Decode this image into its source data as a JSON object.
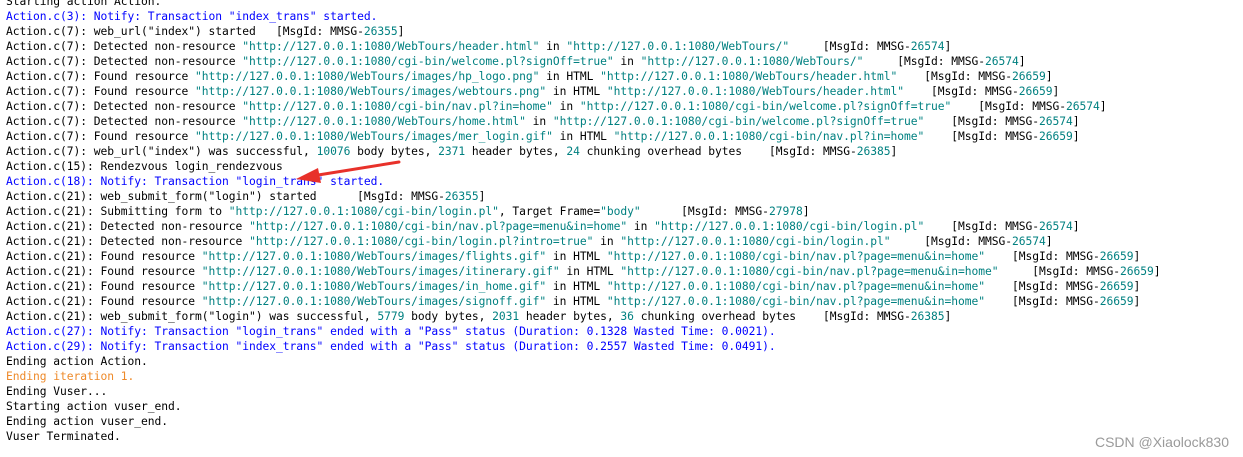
{
  "log": {
    "lines": [
      {
        "color": "black",
        "segs": [
          {
            "t": "Starting action Action."
          }
        ]
      },
      {
        "color": "blue",
        "segs": [
          {
            "t": "Action.c(3): Notify: Transaction \"index_trans\" started."
          }
        ]
      },
      {
        "color": "black",
        "segs": [
          {
            "t": "Action.c(7): web_url(\"index\") started   [MsgId: MMSG-"
          },
          {
            "t": "26355",
            "hl": true
          },
          {
            "t": "]"
          }
        ]
      },
      {
        "color": "black",
        "segs": [
          {
            "t": "Action.c(7): Detected non-resource "
          },
          {
            "t": "\"http://127.0.0.1:1080/WebTours/header.html\"",
            "hl": true
          },
          {
            "t": " in "
          },
          {
            "t": "\"http://127.0.0.1:1080/WebTours/\"",
            "hl": true
          },
          {
            "t": "     [MsgId: MMSG-"
          },
          {
            "t": "26574",
            "hl": true
          },
          {
            "t": "]"
          }
        ]
      },
      {
        "color": "black",
        "segs": [
          {
            "t": "Action.c(7): Detected non-resource "
          },
          {
            "t": "\"http://127.0.0.1:1080/cgi-bin/welcome.pl?signOff=true\"",
            "hl": true
          },
          {
            "t": " in "
          },
          {
            "t": "\"http://127.0.0.1:1080/WebTours/\"",
            "hl": true
          },
          {
            "t": "     [MsgId: MMSG-"
          },
          {
            "t": "26574",
            "hl": true
          },
          {
            "t": "]"
          }
        ]
      },
      {
        "color": "black",
        "segs": [
          {
            "t": "Action.c(7): Found resource "
          },
          {
            "t": "\"http://127.0.0.1:1080/WebTours/images/hp_logo.png\"",
            "hl": true
          },
          {
            "t": " in HTML "
          },
          {
            "t": "\"http://127.0.0.1:1080/WebTours/header.html\"",
            "hl": true
          },
          {
            "t": "    [MsgId: MMSG-"
          },
          {
            "t": "26659",
            "hl": true
          },
          {
            "t": "]"
          }
        ]
      },
      {
        "color": "black",
        "segs": [
          {
            "t": "Action.c(7): Found resource "
          },
          {
            "t": "\"http://127.0.0.1:1080/WebTours/images/webtours.png\"",
            "hl": true
          },
          {
            "t": " in HTML "
          },
          {
            "t": "\"http://127.0.0.1:1080/WebTours/header.html\"",
            "hl": true
          },
          {
            "t": "    [MsgId: MMSG-"
          },
          {
            "t": "26659",
            "hl": true
          },
          {
            "t": "]"
          }
        ]
      },
      {
        "color": "black",
        "segs": [
          {
            "t": "Action.c(7): Detected non-resource "
          },
          {
            "t": "\"http://127.0.0.1:1080/cgi-bin/nav.pl?in=home\"",
            "hl": true
          },
          {
            "t": " in "
          },
          {
            "t": "\"http://127.0.0.1:1080/cgi-bin/welcome.pl?signOff=true\"",
            "hl": true
          },
          {
            "t": "    [MsgId: MMSG-"
          },
          {
            "t": "26574",
            "hl": true
          },
          {
            "t": "]"
          }
        ]
      },
      {
        "color": "black",
        "segs": [
          {
            "t": "Action.c(7): Detected non-resource "
          },
          {
            "t": "\"http://127.0.0.1:1080/WebTours/home.html\"",
            "hl": true
          },
          {
            "t": " in "
          },
          {
            "t": "\"http://127.0.0.1:1080/cgi-bin/welcome.pl?signOff=true\"",
            "hl": true
          },
          {
            "t": "    [MsgId: MMSG-"
          },
          {
            "t": "26574",
            "hl": true
          },
          {
            "t": "]"
          }
        ]
      },
      {
        "color": "black",
        "segs": [
          {
            "t": "Action.c(7): Found resource "
          },
          {
            "t": "\"http://127.0.0.1:1080/WebTours/images/mer_login.gif\"",
            "hl": true
          },
          {
            "t": " in HTML "
          },
          {
            "t": "\"http://127.0.0.1:1080/cgi-bin/nav.pl?in=home\"",
            "hl": true
          },
          {
            "t": "    [MsgId: MMSG-"
          },
          {
            "t": "26659",
            "hl": true
          },
          {
            "t": "]"
          }
        ]
      },
      {
        "color": "black",
        "segs": [
          {
            "t": "Action.c(7): web_url(\"index\") was successful, "
          },
          {
            "t": "10076",
            "hl": true
          },
          {
            "t": " body bytes, "
          },
          {
            "t": "2371",
            "hl": true
          },
          {
            "t": " header bytes, "
          },
          {
            "t": "24",
            "hl": true
          },
          {
            "t": " chunking overhead bytes    [MsgId: MMSG-"
          },
          {
            "t": "26385",
            "hl": true
          },
          {
            "t": "]"
          }
        ]
      },
      {
        "color": "black",
        "segs": [
          {
            "t": "Action.c(15): Rendezvous login_rendezvous"
          }
        ]
      },
      {
        "color": "blue",
        "segs": [
          {
            "t": "Action.c(18): Notify: Transaction \"login_trans\" started."
          }
        ]
      },
      {
        "color": "black",
        "segs": [
          {
            "t": "Action.c(21): web_submit_form(\"login\") started      [MsgId: MMSG-"
          },
          {
            "t": "26355",
            "hl": true
          },
          {
            "t": "]"
          }
        ]
      },
      {
        "color": "black",
        "segs": [
          {
            "t": "Action.c(21): Submitting form to "
          },
          {
            "t": "\"http://127.0.0.1:1080/cgi-bin/login.pl\"",
            "hl": true
          },
          {
            "t": ", Target Frame="
          },
          {
            "t": "\"body\"",
            "hl": true
          },
          {
            "t": "      [MsgId: MMSG-"
          },
          {
            "t": "27978",
            "hl": true
          },
          {
            "t": "]"
          }
        ]
      },
      {
        "color": "black",
        "segs": [
          {
            "t": "Action.c(21): Detected non-resource "
          },
          {
            "t": "\"http://127.0.0.1:1080/cgi-bin/nav.pl?page=menu&in=home\"",
            "hl": true
          },
          {
            "t": " in "
          },
          {
            "t": "\"http://127.0.0.1:1080/cgi-bin/login.pl\"",
            "hl": true
          },
          {
            "t": "    [MsgId: MMSG-"
          },
          {
            "t": "26574",
            "hl": true
          },
          {
            "t": "]"
          }
        ]
      },
      {
        "color": "black",
        "segs": [
          {
            "t": "Action.c(21): Detected non-resource "
          },
          {
            "t": "\"http://127.0.0.1:1080/cgi-bin/login.pl?intro=true\"",
            "hl": true
          },
          {
            "t": " in "
          },
          {
            "t": "\"http://127.0.0.1:1080/cgi-bin/login.pl\"",
            "hl": true
          },
          {
            "t": "     [MsgId: MMSG-"
          },
          {
            "t": "26574",
            "hl": true
          },
          {
            "t": "]"
          }
        ]
      },
      {
        "color": "black",
        "segs": [
          {
            "t": "Action.c(21): Found resource "
          },
          {
            "t": "\"http://127.0.0.1:1080/WebTours/images/flights.gif\"",
            "hl": true
          },
          {
            "t": " in HTML "
          },
          {
            "t": "\"http://127.0.0.1:1080/cgi-bin/nav.pl?page=menu&in=home\"",
            "hl": true
          },
          {
            "t": "    [MsgId: MMSG-"
          },
          {
            "t": "26659",
            "hl": true
          },
          {
            "t": "]"
          }
        ]
      },
      {
        "color": "black",
        "segs": [
          {
            "t": "Action.c(21): Found resource "
          },
          {
            "t": "\"http://127.0.0.1:1080/WebTours/images/itinerary.gif\"",
            "hl": true
          },
          {
            "t": " in HTML "
          },
          {
            "t": "\"http://127.0.0.1:1080/cgi-bin/nav.pl?page=menu&in=home\"",
            "hl": true
          },
          {
            "t": "     [MsgId: MMSG-"
          },
          {
            "t": "26659",
            "hl": true
          },
          {
            "t": "]"
          }
        ]
      },
      {
        "color": "black",
        "segs": [
          {
            "t": "Action.c(21): Found resource "
          },
          {
            "t": "\"http://127.0.0.1:1080/WebTours/images/in_home.gif\"",
            "hl": true
          },
          {
            "t": " in HTML "
          },
          {
            "t": "\"http://127.0.0.1:1080/cgi-bin/nav.pl?page=menu&in=home\"",
            "hl": true
          },
          {
            "t": "    [MsgId: MMSG-"
          },
          {
            "t": "26659",
            "hl": true
          },
          {
            "t": "]"
          }
        ]
      },
      {
        "color": "black",
        "segs": [
          {
            "t": "Action.c(21): Found resource "
          },
          {
            "t": "\"http://127.0.0.1:1080/WebTours/images/signoff.gif\"",
            "hl": true
          },
          {
            "t": " in HTML "
          },
          {
            "t": "\"http://127.0.0.1:1080/cgi-bin/nav.pl?page=menu&in=home\"",
            "hl": true
          },
          {
            "t": "    [MsgId: MMSG-"
          },
          {
            "t": "26659",
            "hl": true
          },
          {
            "t": "]"
          }
        ]
      },
      {
        "color": "black",
        "segs": [
          {
            "t": "Action.c(21): web_submit_form(\"login\") was successful, "
          },
          {
            "t": "5779",
            "hl": true
          },
          {
            "t": " body bytes, "
          },
          {
            "t": "2031",
            "hl": true
          },
          {
            "t": " header bytes, "
          },
          {
            "t": "36",
            "hl": true
          },
          {
            "t": " chunking overhead bytes    [MsgId: MMSG-"
          },
          {
            "t": "26385",
            "hl": true
          },
          {
            "t": "]"
          }
        ]
      },
      {
        "color": "blue",
        "segs": [
          {
            "t": "Action.c(27): Notify: Transaction \"login_trans\" ended with a \"Pass\" status (Duration: 0.1328 Wasted Time: 0.0021)."
          }
        ]
      },
      {
        "color": "blue",
        "segs": [
          {
            "t": "Action.c(29): Notify: Transaction \"index_trans\" ended with a \"Pass\" status (Duration: 0.2557 Wasted Time: 0.0491)."
          }
        ]
      },
      {
        "color": "black",
        "segs": [
          {
            "t": "Ending action Action."
          }
        ]
      },
      {
        "color": "orange",
        "segs": [
          {
            "t": "Ending iteration 1."
          }
        ]
      },
      {
        "color": "black",
        "segs": [
          {
            "t": "Ending Vuser..."
          }
        ]
      },
      {
        "color": "black",
        "segs": [
          {
            "t": "Starting action vuser_end."
          }
        ]
      },
      {
        "color": "black",
        "segs": [
          {
            "t": "Ending action vuser_end."
          }
        ]
      },
      {
        "color": "black",
        "segs": [
          {
            "t": "Vuser Terminated."
          }
        ]
      }
    ],
    "colors": {
      "black": "#000000",
      "blue": "#0000ff",
      "orange": "#ee8a2a",
      "highlight": "#008080",
      "arrow": "#e8312a"
    }
  },
  "watermark": "CSDN @Xiaolock830"
}
